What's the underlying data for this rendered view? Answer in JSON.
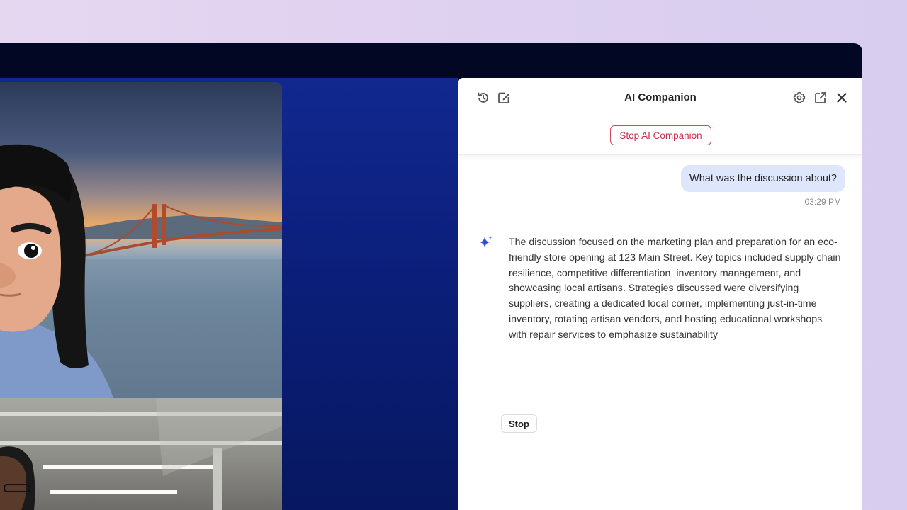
{
  "panel": {
    "title": "AI Companion",
    "stop_ai_label": "Stop AI Companion",
    "icons": {
      "history": "history-icon",
      "compose": "compose-icon",
      "settings": "gear-icon",
      "popout": "popout-icon",
      "close": "close-icon",
      "assistant": "sparkle-icon"
    }
  },
  "chat": {
    "user_message": "What was the discussion about?",
    "user_time": "03:29 PM",
    "ai_response": "The discussion focused on the marketing plan and preparation for an eco-friendly store opening at 123 Main Street. Key topics included supply chain resilience, competitive differentiation, inventory management, and showcasing local artisans. Strategies discussed were diversifying suppliers, creating a dedicated local corner, implementing just-in-time inventory, rotating artisan vendors, and hosting educational workshops with repair services to emphasize sustainability",
    "stop_label": "Stop"
  },
  "colors": {
    "accent_red": "#c8304a",
    "user_bubble": "#dde6fb",
    "assistant_icon": "#2f4ee0",
    "meeting_bg": "#0b1f7a"
  }
}
